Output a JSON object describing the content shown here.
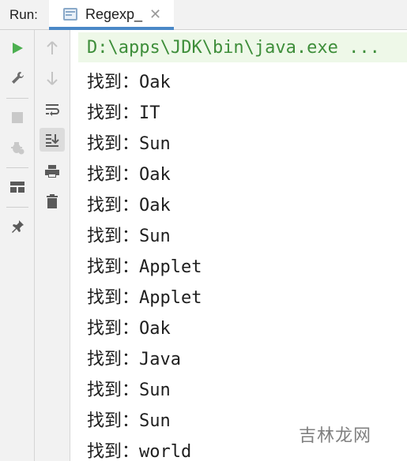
{
  "header": {
    "run_label": "Run:",
    "tab_title": "Regexp_",
    "tab_close": "✕"
  },
  "left_toolbar": [
    "run-icon",
    "wrench-icon",
    "stop-icon",
    "debug-icon",
    "layout-icon",
    "pin-icon"
  ],
  "mid_toolbar": [
    "arrow-up-icon",
    "arrow-down-icon",
    "soft-wrap-icon",
    "scroll-to-end-icon",
    "print-icon",
    "trash-icon"
  ],
  "console": {
    "command": "D:\\apps\\JDK\\bin\\java.exe ...",
    "lines": [
      "找到：Oak",
      "找到：IT",
      "找到：Sun",
      "找到：Oak",
      "找到：Oak",
      "找到：Sun",
      "找到：Applet",
      "找到：Applet",
      "找到：Oak",
      "找到：Java",
      "找到：Sun",
      "找到：Sun",
      "找到：world"
    ]
  },
  "watermark": "吉林龙网",
  "colors": {
    "run_green": "#4caf50",
    "command_green": "#3e8e3a",
    "command_bg": "#eef8e8",
    "tab_underline": "#4a88c7",
    "icon_gray": "#6e6e6e"
  }
}
